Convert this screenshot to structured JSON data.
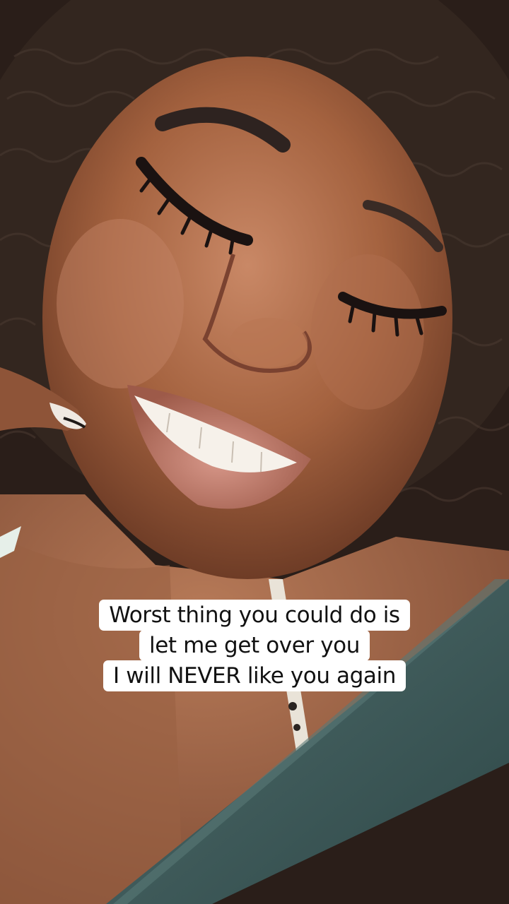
{
  "caption": {
    "lines": [
      "Worst thing you could do is",
      "let me get over you",
      "I will NEVER like you again"
    ]
  },
  "colors": {
    "caption_background": "#ffffff",
    "caption_text": "#111111",
    "skin": "#a8684a",
    "hair": "#2b1f1a",
    "seatbelt": "#3e5a5a"
  }
}
